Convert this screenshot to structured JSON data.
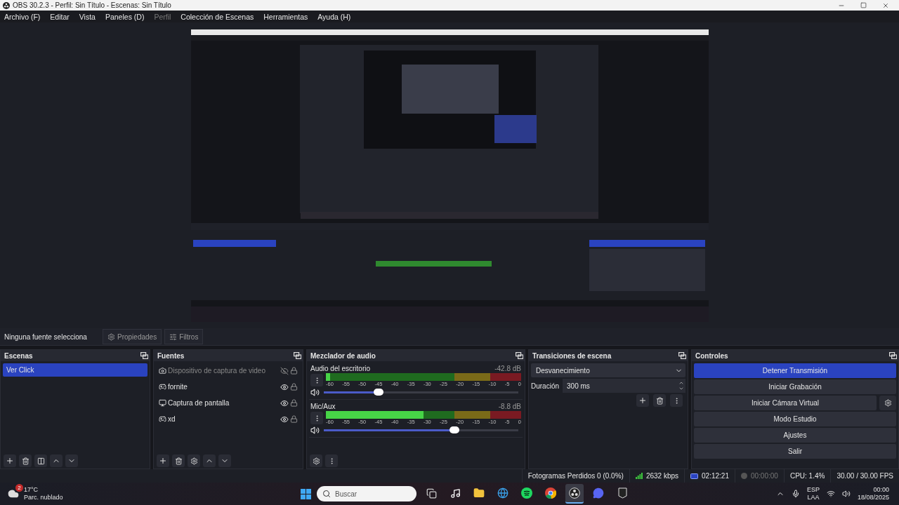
{
  "window": {
    "title": "OBS 30.2.3 - Perfil: Sin Título - Escenas: Sin Título"
  },
  "menu": [
    {
      "label": "Archivo (F)",
      "disabled": false
    },
    {
      "label": "Editar",
      "disabled": false
    },
    {
      "label": "Vista",
      "disabled": false
    },
    {
      "label": "Paneles (D)",
      "disabled": false
    },
    {
      "label": "Perfil",
      "disabled": true
    },
    {
      "label": "Colección de Escenas",
      "disabled": false
    },
    {
      "label": "Herramientas",
      "disabled": false
    },
    {
      "label": "Ayuda (H)",
      "disabled": false
    }
  ],
  "context_bar": {
    "label": "Ninguna fuente selecciona",
    "buttons": [
      "Propiedades",
      "Filtros"
    ]
  },
  "scenes": {
    "title": "Escenas",
    "items": [
      {
        "label": "Ver Click",
        "selected": true
      }
    ]
  },
  "sources": {
    "title": "Fuentes",
    "items": [
      {
        "label": "Dispositivo de captura de video",
        "kind": "camera",
        "visible": false
      },
      {
        "label": "fornite",
        "kind": "game",
        "visible": true
      },
      {
        "label": "Captura de pantalla",
        "kind": "display",
        "visible": true
      },
      {
        "label": "xd",
        "kind": "game",
        "visible": true
      }
    ]
  },
  "mixer": {
    "title": "Mezclador de audio",
    "channels": [
      {
        "name": "Audio del escritorio",
        "reading": "-42.8 dB",
        "meter": {
          "level": 0.02
        },
        "volume": {
          "level": 0.28
        },
        "scale": [
          "-60",
          "-55",
          "-50",
          "-45",
          "-40",
          "-35",
          "-30",
          "-25",
          "-20",
          "-15",
          "-10",
          "-5",
          "0"
        ]
      },
      {
        "name": "Mic/Aux",
        "reading": "-8.8 dB",
        "meter": {
          "level": 0.5
        },
        "volume": {
          "level": 0.67
        },
        "scale": [
          "-60",
          "-55",
          "-50",
          "-45",
          "-40",
          "-35",
          "-30",
          "-25",
          "-20",
          "-15",
          "-10",
          "-5",
          "0"
        ]
      }
    ]
  },
  "transitions": {
    "title": "Transiciones de escena",
    "selected": "Desvanecimiento",
    "duration_label": "Duración",
    "duration": "300 ms"
  },
  "controls": {
    "title": "Controles",
    "buttons": [
      {
        "label": "Detener Transmisión",
        "active": true,
        "settings": false
      },
      {
        "label": "Iniciar Grabación",
        "active": false,
        "settings": false
      },
      {
        "label": "Iniciar Cámara Virtual",
        "active": false,
        "settings": true
      },
      {
        "label": "Modo Estudio",
        "active": false,
        "settings": false
      },
      {
        "label": "Ajustes",
        "active": false,
        "settings": false
      },
      {
        "label": "Salir",
        "active": false,
        "settings": false
      }
    ]
  },
  "status_bar": {
    "dropped": "Fotogramas Perdidos 0 (0.0%)",
    "bitrate": "2632 kbps",
    "stream_time": "02:12:21",
    "record_time": "00:00:00",
    "cpu": "CPU: 1.4%",
    "fps": "30.00 / 30.00 FPS"
  },
  "taskbar": {
    "weather": {
      "badge": "2",
      "temp": "17°C",
      "desc": "Parc. nublado"
    },
    "search": {
      "placeholder": "Buscar"
    },
    "apps": [
      {
        "kind": "taskview",
        "selected": false
      },
      {
        "kind": "tiktok",
        "selected": false
      },
      {
        "kind": "folder",
        "selected": false
      },
      {
        "kind": "edge",
        "selected": false
      },
      {
        "kind": "spotify",
        "selected": false
      },
      {
        "kind": "chrome",
        "selected": false
      },
      {
        "kind": "obs",
        "selected": true
      },
      {
        "kind": "discord",
        "selected": false
      },
      {
        "kind": "epic",
        "selected": false
      }
    ],
    "lang": [
      "ESP",
      "LAA"
    ],
    "time": "00:00",
    "date": "18/08/2025"
  }
}
